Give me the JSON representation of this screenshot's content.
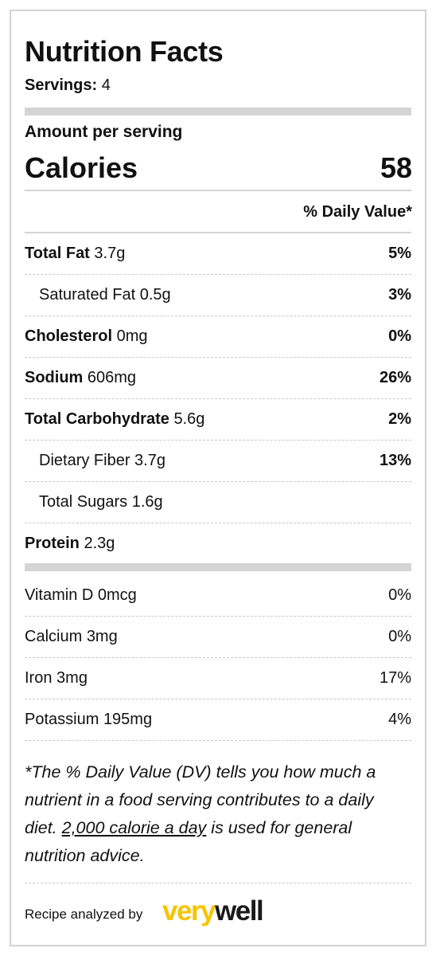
{
  "header": {
    "title": "Nutrition Facts",
    "servings_label": "Servings:",
    "servings_value": "4"
  },
  "calories": {
    "amount_label": "Amount per serving",
    "label": "Calories",
    "value": "58"
  },
  "daily_value_header": "% Daily Value*",
  "nutrients": [
    {
      "name": "Total Fat",
      "amount": "3.7g",
      "dv": "5%"
    },
    {
      "name": "Saturated Fat",
      "amount": "0.5g",
      "dv": "3%"
    },
    {
      "name": "Cholesterol",
      "amount": "0mg",
      "dv": "0%"
    },
    {
      "name": "Sodium",
      "amount": "606mg",
      "dv": "26%"
    },
    {
      "name": "Total Carbohydrate",
      "amount": "5.6g",
      "dv": "2%"
    },
    {
      "name": "Dietary Fiber",
      "amount": "3.7g",
      "dv": "13%"
    },
    {
      "name": "Total Sugars",
      "amount": "1.6g",
      "dv": ""
    },
    {
      "name": "Protein",
      "amount": "2.3g",
      "dv": ""
    }
  ],
  "vitamins": [
    {
      "name": "Vitamin D",
      "amount": "0mcg",
      "dv": "0%"
    },
    {
      "name": "Calcium",
      "amount": "3mg",
      "dv": "0%"
    },
    {
      "name": "Iron",
      "amount": "3mg",
      "dv": "17%"
    },
    {
      "name": "Potassium",
      "amount": "195mg",
      "dv": "4%"
    }
  ],
  "footnote": {
    "text_before": "*The % Daily Value (DV) tells you how much a nutrient in a food serving contributes to a daily diet. ",
    "link": "2,000 calorie a day",
    "text_after": " is used for general nutrition advice."
  },
  "footer": {
    "recipe_label": "Recipe analyzed by",
    "logo_very": "very",
    "logo_well": "well"
  },
  "colors": {
    "border": "#d4d4d4",
    "brand_yellow": "#f6c400",
    "text": "#111111"
  }
}
